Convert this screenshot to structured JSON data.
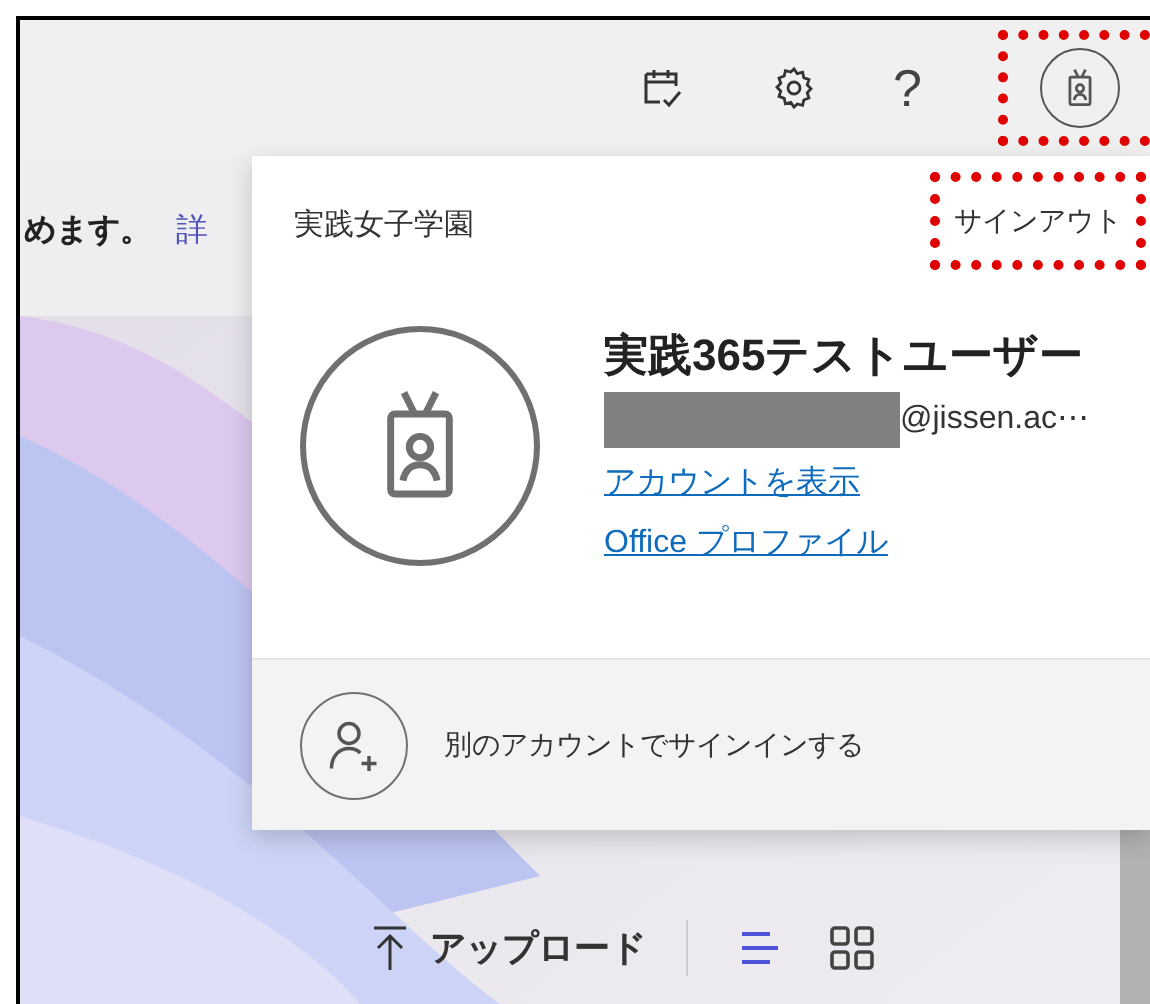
{
  "top_bar": {
    "help_label": "?"
  },
  "page": {
    "message": "めます。",
    "link": "詳"
  },
  "account_panel": {
    "organization": "実践女子学園",
    "sign_out": "サインアウト",
    "user_name": "実践365テストユーザー",
    "email": "@jissen.ac⋯",
    "links": [
      "アカウントを表示",
      "Office プロファイル"
    ],
    "other_account": "別のアカウントでサインインする"
  },
  "toolbar": {
    "upload": "アップロード",
    "views": [
      {
        "kind": "list",
        "selected": true
      },
      {
        "kind": "grid",
        "selected": false
      }
    ]
  }
}
